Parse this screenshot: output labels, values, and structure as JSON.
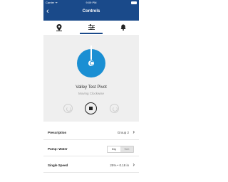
{
  "status_bar": {
    "carrier": "Carrier ᯤ",
    "time": "9:09 PM"
  },
  "header": {
    "title": "Controls"
  },
  "tabs": [
    {
      "icon": "map-pin-icon",
      "active": false
    },
    {
      "icon": "sliders-icon",
      "active": true
    },
    {
      "icon": "bell-icon",
      "active": false
    }
  ],
  "pivot": {
    "name": "Valley Test Pivot",
    "status": "Moving Clockwise"
  },
  "settings": {
    "prescription": {
      "label": "Prescription",
      "value": "Group 2"
    },
    "pump": {
      "label": "Pump: Water",
      "options": [
        "Dry",
        "Wet"
      ],
      "selected": "Dry"
    },
    "speed": {
      "label": "Single Speed",
      "value": "25% • 0.18 in"
    }
  },
  "colors": {
    "header": "#1a4a8a",
    "accent": "#1a8fd3",
    "panel": "#efefef"
  }
}
